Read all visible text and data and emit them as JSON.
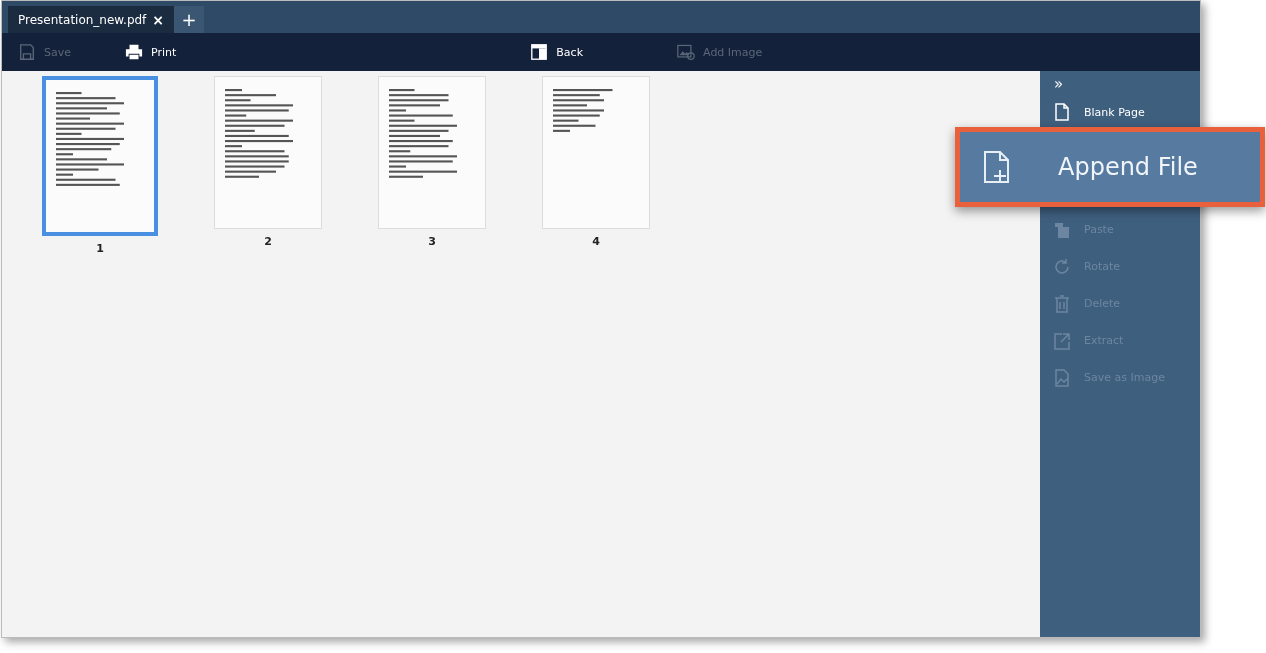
{
  "tabs": [
    {
      "label": "Presentation_new.pdf",
      "selected": true,
      "close": "×"
    }
  ],
  "new_tab": "+",
  "toolbar": [
    {
      "kind": "save",
      "label": "Save",
      "disabled": true
    },
    {
      "kind": "print",
      "label": "Print",
      "disabled": false
    },
    {
      "kind": "back",
      "label": "Back",
      "disabled": false
    },
    {
      "kind": "add-image",
      "label": "Add Image",
      "disabled": true
    }
  ],
  "pages": [
    {
      "number": "1",
      "selected": true
    },
    {
      "number": "2",
      "selected": false
    },
    {
      "number": "3",
      "selected": false
    },
    {
      "number": "4",
      "selected": false
    }
  ],
  "sidebar": {
    "collapse": "»",
    "items": [
      {
        "kind": "blank-page",
        "label": "Blank Page",
        "disabled": false
      },
      {
        "kind": "paste",
        "label": "Paste",
        "disabled": true
      },
      {
        "kind": "rotate",
        "label": "Rotate",
        "disabled": true
      },
      {
        "kind": "delete",
        "label": "Delete",
        "disabled": true
      },
      {
        "kind": "extract",
        "label": "Extract",
        "disabled": true
      },
      {
        "kind": "save-image",
        "label": "Save as Image",
        "disabled": true
      }
    ]
  },
  "callout": {
    "label": "Append File"
  }
}
